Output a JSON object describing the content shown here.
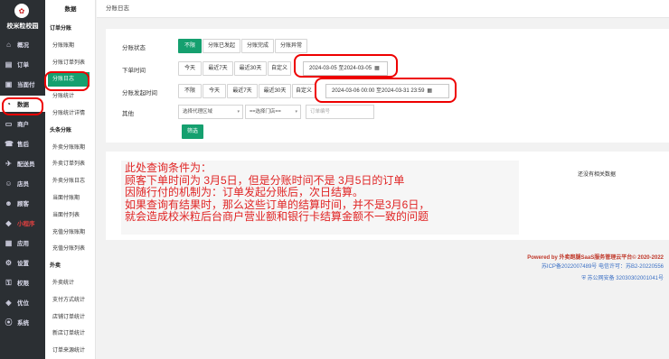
{
  "sidebar": {
    "brand": "校米粒校园",
    "logo_glyph": "✿",
    "items": [
      {
        "label": "概况",
        "icon": "home-icon",
        "glyph": "⌂"
      },
      {
        "label": "订单",
        "icon": "order-icon",
        "glyph": "▤"
      },
      {
        "label": "当面付",
        "icon": "pay-icon",
        "glyph": "▣"
      },
      {
        "label": "数据",
        "icon": "data-icon",
        "glyph": "◔"
      },
      {
        "label": "商户",
        "icon": "merchant-icon",
        "glyph": "▭"
      },
      {
        "label": "售后",
        "icon": "aftersale-icon",
        "glyph": "☎"
      },
      {
        "label": "配送员",
        "icon": "courier-icon",
        "glyph": "✈"
      },
      {
        "label": "店员",
        "icon": "clerk-icon",
        "glyph": "☺"
      },
      {
        "label": "顾客",
        "icon": "customer-icon",
        "glyph": "☻"
      },
      {
        "label": "小程序",
        "icon": "miniapp-icon",
        "glyph": "◆"
      },
      {
        "label": "应用",
        "icon": "apps-icon",
        "glyph": "▦"
      },
      {
        "label": "设置",
        "icon": "settings-icon",
        "glyph": "⚙"
      },
      {
        "label": "权限",
        "icon": "permission-icon",
        "glyph": "⚿"
      },
      {
        "label": "优位",
        "icon": "position-icon",
        "glyph": "◈"
      },
      {
        "label": "系统",
        "icon": "system-icon",
        "glyph": "⦿"
      }
    ]
  },
  "subnav": {
    "title": "数据",
    "items": [
      {
        "label": "订单分账",
        "group": true
      },
      {
        "label": "分账账期"
      },
      {
        "label": "分账订单列表"
      },
      {
        "label": "分账日志"
      },
      {
        "label": "分账统计"
      },
      {
        "label": "分账统计详情"
      },
      {
        "label": "头条分账",
        "group": true
      },
      {
        "label": "外卖分账账期"
      },
      {
        "label": "外卖订单列表"
      },
      {
        "label": "外卖分账日志"
      },
      {
        "label": "当面付账期"
      },
      {
        "label": "当面付列表"
      },
      {
        "label": "充值分账账期"
      },
      {
        "label": "充值分账列表"
      },
      {
        "label": "外卖",
        "group": true
      },
      {
        "label": "外卖统计"
      },
      {
        "label": "支付方式统计"
      },
      {
        "label": "店铺订单统计"
      },
      {
        "label": "新店订单统计"
      },
      {
        "label": "订单来源统计"
      }
    ]
  },
  "page": {
    "title": "分账日志"
  },
  "filters": {
    "status_label": "分账状态",
    "status_options": [
      "不限",
      "分账已发起",
      "分账完成",
      "分账异常"
    ],
    "order_time_label": "下单时间",
    "order_time_options": [
      "今天",
      "最近7天",
      "最近30天",
      "自定义"
    ],
    "order_time_value": "2024-03-05 至2024-03-05",
    "split_time_label": "分账发起时间",
    "split_time_options": [
      "不限",
      "今天",
      "最近7天",
      "最近30天",
      "自定义"
    ],
    "split_time_value": "2024-03-06 00:00 至2024-03-31 23:59",
    "other_label": "其他",
    "area_select": "选择代理区域",
    "store_select": "==选择门店==",
    "order_no_placeholder": "订单编号",
    "search_label": "筛选"
  },
  "result": {
    "empty_text": "还没有相关数据"
  },
  "annotation": {
    "lines": [
      "此处查询条件为：",
      "顾客下单时间为 3月5日，但是分账时间不是 3月5日的订单",
      "因随行付的机制为：订单发起分账后，次日结算。",
      "如果查询有结果时，那么这些订单的结算时间，并不是3月6日，",
      "就会造成校米粒后台商户营业额和银行卡结算金额不一致的问题"
    ]
  },
  "footer": {
    "powered": "Powered by 外卖跑腿SaaS服务管理云平台© 2020-2022",
    "icp": "苏ICP备2022007489号   电信许可：苏B2-20220556",
    "police": "苏公网安备 32030302001041号"
  },
  "colors": {
    "accent": "#15a06f",
    "annotation": "#e02424",
    "highlight_circle": "#ee0000"
  }
}
